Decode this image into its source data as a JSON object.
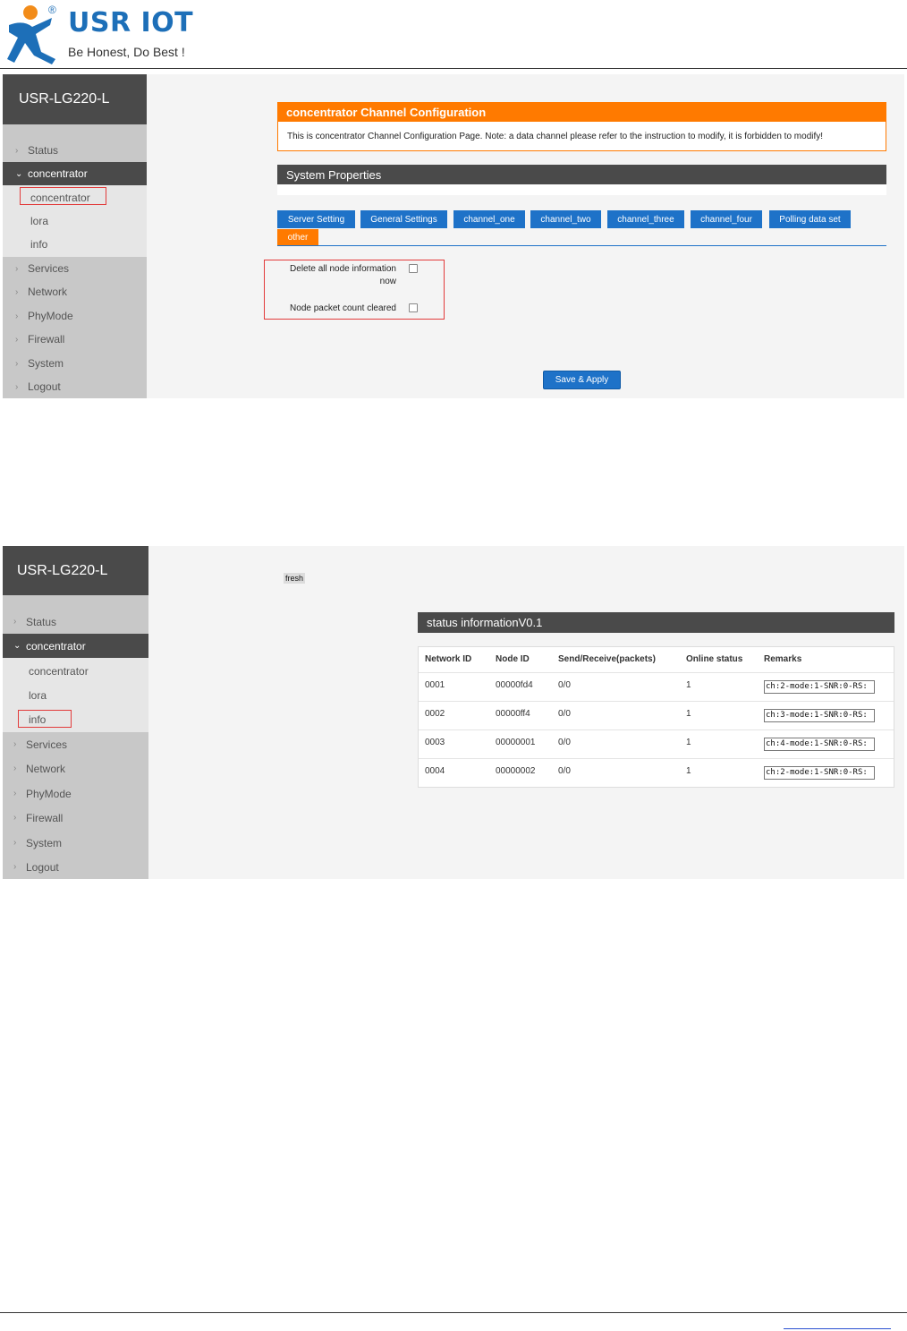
{
  "header": {
    "brand": "USR IOT",
    "registered": "®",
    "tagline": "Be Honest, Do Best !"
  },
  "shot1": {
    "device": "USR-LG220-L",
    "nav": {
      "status": "Status",
      "concentrator": "concentrator",
      "sub_concentrator": "concentrator",
      "sub_lora": "lora",
      "sub_info": "info",
      "services": "Services",
      "network": "Network",
      "phymode": "PhyMode",
      "firewall": "Firewall",
      "system": "System",
      "logout": "Logout"
    },
    "config_title": "concentrator Channel Configuration",
    "config_note": "This is concentrator Channel Configuration Page.  Note: a data channel please refer to the instruction to modify, it is forbidden to modify!",
    "section_title": "System Properties",
    "tabs": [
      "Server Setting",
      "General Settings",
      "channel_one",
      "channel_two",
      "channel_three",
      "channel_four",
      "Polling data set"
    ],
    "tab_active": "other",
    "opt_delete_line1": "Delete all node information",
    "opt_delete_line2": "now",
    "opt_clear": "Node packet count cleared",
    "save_label": "Save & Apply"
  },
  "shot2": {
    "device": "USR-LG220-L",
    "fresh": "fresh",
    "nav": {
      "status": "Status",
      "concentrator": "concentrator",
      "sub_concentrator": "concentrator",
      "sub_lora": "lora",
      "sub_info": "info",
      "services": "Services",
      "network": "Network",
      "phymode": "PhyMode",
      "firewall": "Firewall",
      "system": "System",
      "logout": "Logout"
    },
    "panel_title": "status informationV0.1",
    "columns": [
      "Network ID",
      "Node ID",
      "Send/Receive(packets)",
      "Online status",
      "Remarks"
    ],
    "rows": [
      {
        "network_id": "0001",
        "node_id": "00000fd4",
        "send_receive": "0/0",
        "online": "1",
        "remarks": "ch:2-mode:1-SNR:0-RS:"
      },
      {
        "network_id": "0002",
        "node_id": "00000ff4",
        "send_receive": "0/0",
        "online": "1",
        "remarks": "ch:3-mode:1-SNR:0-RS:"
      },
      {
        "network_id": "0003",
        "node_id": "00000001",
        "send_receive": "0/0",
        "online": "1",
        "remarks": "ch:4-mode:1-SNR:0-RS:"
      },
      {
        "network_id": "0004",
        "node_id": "00000002",
        "send_receive": "0/0",
        "online": "1",
        "remarks": "ch:2-mode:1-SNR:0-RS:"
      }
    ]
  },
  "colors": {
    "brand_blue": "#1d6fb8",
    "accent_orange": "#ff7a00",
    "tab_blue": "#1e72c8",
    "dark_bar": "#4a4a4a",
    "highlight_red": "#e23b3b"
  },
  "icons": [
    "usr-iot-logo-icon",
    "chevron-right-icon",
    "chevron-down-icon",
    "checkbox-icon"
  ]
}
